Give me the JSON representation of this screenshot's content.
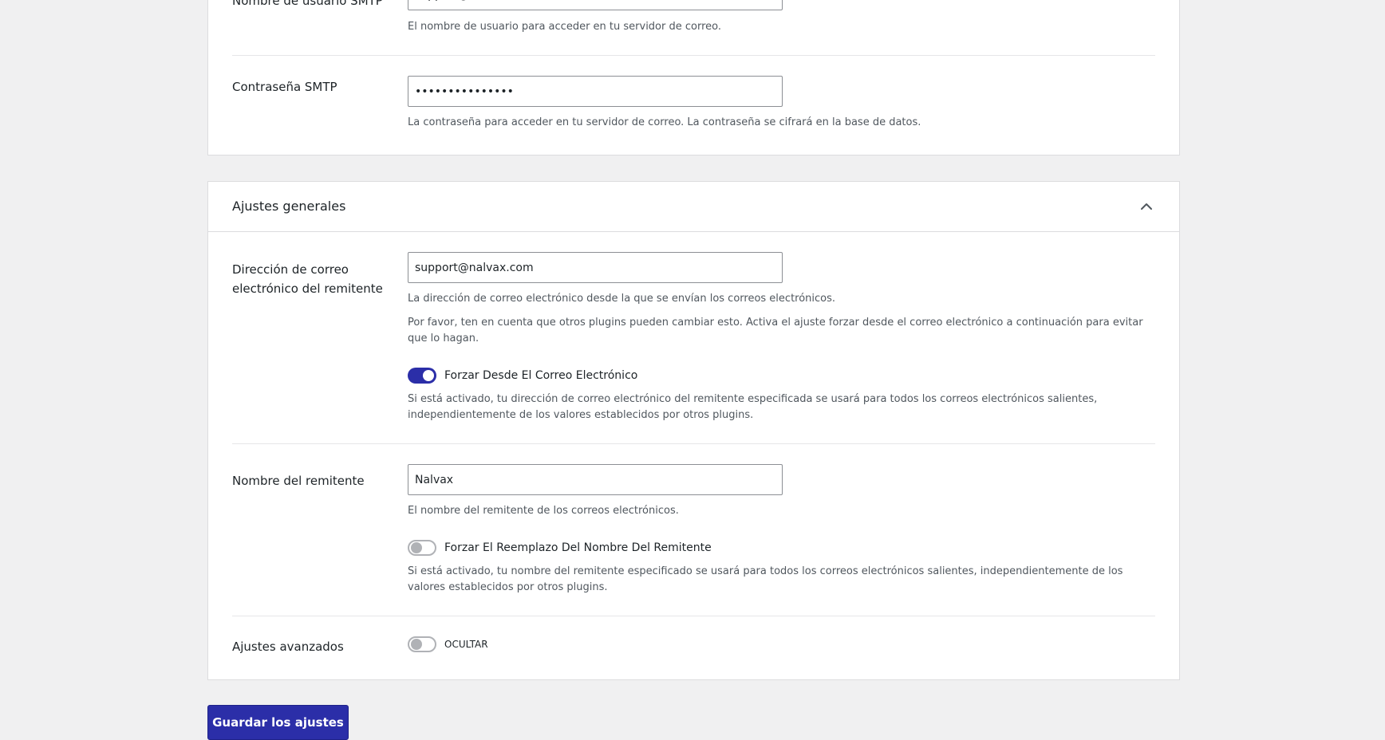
{
  "smtp_section": {
    "username": {
      "label": "Nombre de usuario SMTP",
      "value": "support@nalvax.com",
      "description": "El nombre de usuario para acceder en tu servidor de correo."
    },
    "password": {
      "label": "Contraseña SMTP",
      "value": "•••••••••••••••",
      "description": "La contraseña para acceder en tu servidor de correo. La contraseña se cifrará en la base de datos."
    }
  },
  "general_section": {
    "title": "Ajustes generales",
    "from_email": {
      "label": "Dirección de correo electrónico del remitente",
      "value": "support@nalvax.com",
      "description": "La dirección de correo electrónico desde la que se envían los correos electrónicos.",
      "note": "Por favor, ten en cuenta que otros plugins pueden cambiar esto. Activa el ajuste forzar desde el correo electrónico a continuación para evitar que lo hagan.",
      "force_toggle": {
        "label": "Forzar Desde El Correo Electrónico",
        "enabled": true,
        "description": "Si está activado, tu dirección de correo electrónico del remitente especificada se usará para todos los correos electrónicos salientes, independientemente de los valores establecidos por otros plugins."
      }
    },
    "from_name": {
      "label": "Nombre del remitente",
      "value": "Nalvax",
      "description": "El nombre del remitente de los correos electrónicos.",
      "force_toggle": {
        "label": "Forzar El Reemplazo Del Nombre Del Remitente",
        "enabled": false,
        "description": "Si está activado, tu nombre del remitente especificado se usará para todos los correos electrónicos salientes, independientemente de los valores establecidos por otros plugins."
      }
    },
    "advanced": {
      "label": "Ajustes avanzados",
      "toggle_label": "OCULTAR",
      "enabled": false
    }
  },
  "save_button": {
    "label": "Guardar los ajustes"
  },
  "colors": {
    "accent": "#2b2ea8",
    "background": "#f0f0f1",
    "card": "#ffffff",
    "border": "#dcdcde",
    "muted_text": "#50575e"
  },
  "icons": {
    "collapse": "chevron-up-icon"
  }
}
